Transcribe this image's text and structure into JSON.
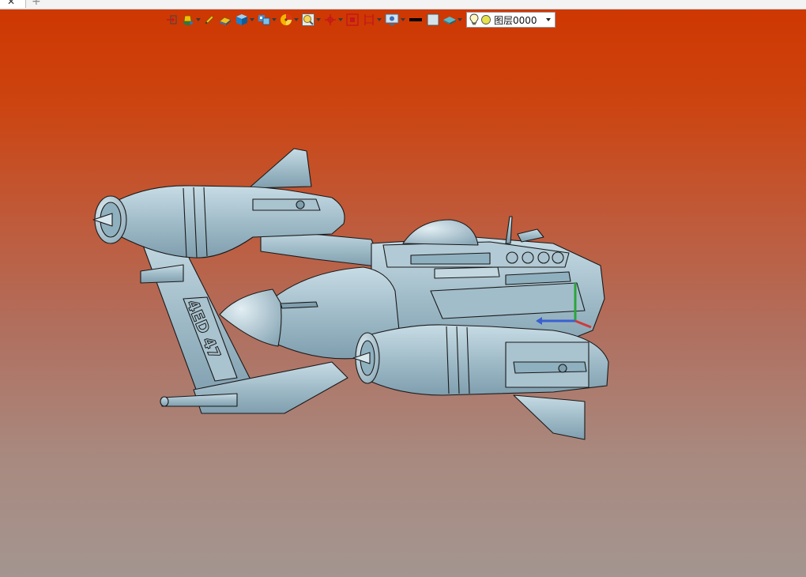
{
  "tabstrip": {
    "close_glyph": "✕",
    "add_glyph": "+"
  },
  "toolbar": {
    "layer_select": {
      "selected": "图层0000"
    },
    "icons": [
      "insert-point-icon",
      "paint-bucket-icon",
      "pencil-icon",
      "eraser-icon",
      "cube-icon",
      "view-cube-icon",
      "color-wheel-icon",
      "zoom-view-icon",
      "origin-axis-icon",
      "snapshot-icon",
      "dimension-icon",
      "display-settings-icon",
      "line-color-swatch",
      "fill-color-swatch",
      "layer-icon",
      "lightbulb-icon"
    ]
  },
  "theme": {
    "bg_top": "#cf3600",
    "bg_bottom": "#a49590",
    "model_fill": "#9db9c6",
    "model_shade": "#7f9eae",
    "model_light": "#c8dde6",
    "outline": "#1a1a1a",
    "swatch_line": "#000000",
    "swatch_fill": "#d4e2ea"
  },
  "model": {
    "side_text": "4ED 47"
  }
}
